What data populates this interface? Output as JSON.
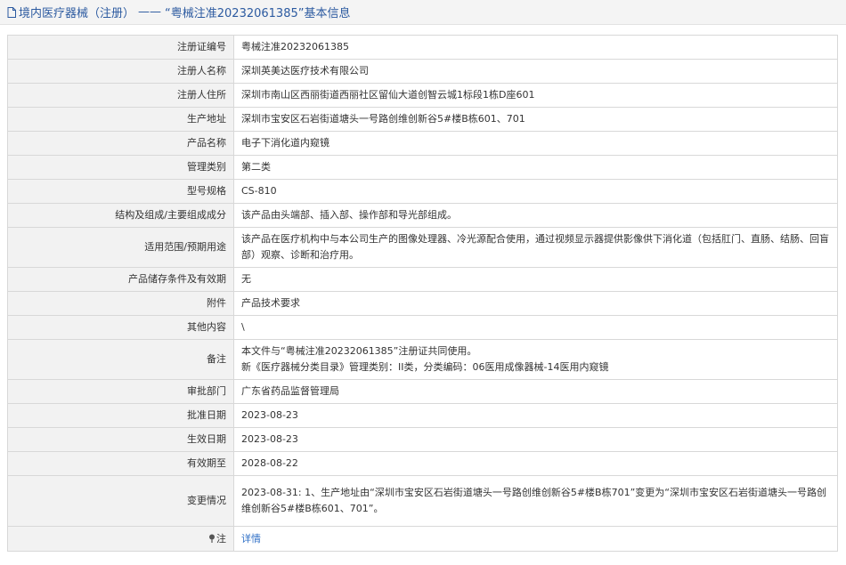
{
  "header": {
    "prefix": "境内医疗器械（注册）",
    "dash": "——",
    "title_main": "“粤械注准20232061385”基本信息"
  },
  "rows": [
    {
      "label": "注册证编号",
      "value": "粤械注准20232061385"
    },
    {
      "label": "注册人名称",
      "value": "深圳英美达医疗技术有限公司"
    },
    {
      "label": "注册人住所",
      "value": "深圳市南山区西丽街道西丽社区留仙大道创智云城1标段1栋D座601"
    },
    {
      "label": "生产地址",
      "value": "深圳市宝安区石岩街道塘头一号路创维创新谷5#楼B栋601、701"
    },
    {
      "label": "产品名称",
      "value": "电子下消化道内窥镜"
    },
    {
      "label": "管理类别",
      "value": "第二类"
    },
    {
      "label": "型号规格",
      "value": "CS-810"
    },
    {
      "label": "结构及组成/主要组成成分",
      "value": "该产品由头端部、插入部、操作部和导光部组成。"
    },
    {
      "label": "适用范围/预期用途",
      "value": "该产品在医疗机构中与本公司生产的图像处理器、冷光源配合使用，通过视频显示器提供影像供下消化道（包括肛门、直肠、结肠、回盲部）观察、诊断和治疗用。"
    },
    {
      "label": "产品储存条件及有效期",
      "value": "无"
    },
    {
      "label": "附件",
      "value": "产品技术要求"
    },
    {
      "label": "其他内容",
      "value": "\\"
    },
    {
      "label": "备注",
      "value_line1": "本文件与“粤械注准20232061385”注册证共同使用。",
      "value_line2": "新《医疗器械分类目录》管理类别：II类，分类编码：06医用成像器械-14医用内窥镜"
    },
    {
      "label": "审批部门",
      "value": "广东省药品监督管理局"
    },
    {
      "label": "批准日期",
      "value": "2023-08-23"
    },
    {
      "label": "生效日期",
      "value": "2023-08-23"
    },
    {
      "label": "有效期至",
      "value": "2028-08-22"
    },
    {
      "label": "变更情况",
      "value": "2023-08-31: 1、生产地址由“深圳市宝安区石岩街道塘头一号路创维创新谷5#楼B栋701”变更为“深圳市宝安区石岩街道塘头一号路创维创新谷5#楼B栋601、701”。"
    },
    {
      "label": "注",
      "value": "详情"
    }
  ],
  "colors": {
    "header_text": "#2c5aa0",
    "label_bg": "#f2f2f2",
    "border": "#d8d8d8",
    "link": "#2f6fc6"
  },
  "icons": {
    "header": "document-icon",
    "note": "pin-icon"
  }
}
